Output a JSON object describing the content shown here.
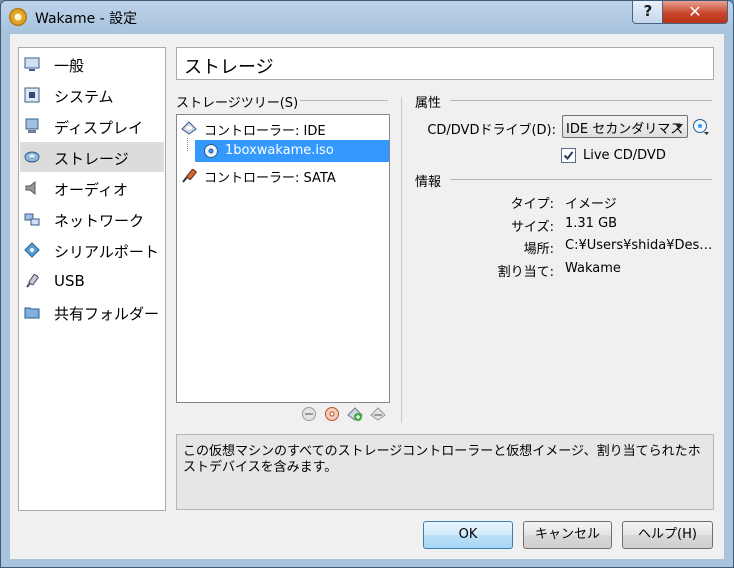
{
  "window": {
    "title": "Wakame - 設定",
    "help_button": "?",
    "close_button": "✕"
  },
  "sidebar": {
    "items": [
      {
        "label": "一般",
        "icon": "monitor-general-icon"
      },
      {
        "label": "システム",
        "icon": "motherboard-chip-icon"
      },
      {
        "label": "ディスプレイ",
        "icon": "display-monitor-icon"
      },
      {
        "label": "ストレージ",
        "icon": "storage-disk-icon",
        "selected": true
      },
      {
        "label": "オーディオ",
        "icon": "speaker-audio-icon"
      },
      {
        "label": "ネットワーク",
        "icon": "network-icon"
      },
      {
        "label": "シリアルポート",
        "icon": "serial-port-icon"
      },
      {
        "label": "USB",
        "icon": "usb-plug-icon"
      },
      {
        "label": "共有フォルダー",
        "icon": "shared-folder-icon"
      }
    ]
  },
  "page_title": "ストレージ",
  "storage_tree": {
    "label": "ストレージツリー(S)",
    "rows": [
      {
        "label": "コントローラー: IDE",
        "icon": "ide-controller-icon"
      },
      {
        "label": "1boxwakame.iso",
        "icon": "cd-disc-icon",
        "selected": true
      },
      {
        "label": "コントローラー: SATA",
        "icon": "sata-controller-icon"
      }
    ]
  },
  "properties": {
    "label": "属性",
    "drive_label": "CD/DVDドライブ(D):",
    "drive_value": "IDE セカンダリマス",
    "live_cd_label": "Live CD/DVD",
    "live_cd_checked": true
  },
  "info": {
    "label": "情報",
    "rows": [
      {
        "key": "タイプ:",
        "value": "イメージ"
      },
      {
        "key": "サイズ:",
        "value": "1.31 GB"
      },
      {
        "key": "場所:",
        "value": "C:¥Users¥shida¥Des…"
      },
      {
        "key": "割り当て:",
        "value": "Wakame"
      }
    ]
  },
  "description": "この仮想マシンのすべてのストレージコントローラーと仮想イメージ、割り当てられたホストデバイスを含みます。",
  "buttons": {
    "ok": "OK",
    "cancel": "キャンセル",
    "help": "ヘルプ(H)"
  },
  "colors": {
    "selection": "#3399ff",
    "title_bar": "#bcd3ea",
    "close_button": "#c9452b"
  }
}
